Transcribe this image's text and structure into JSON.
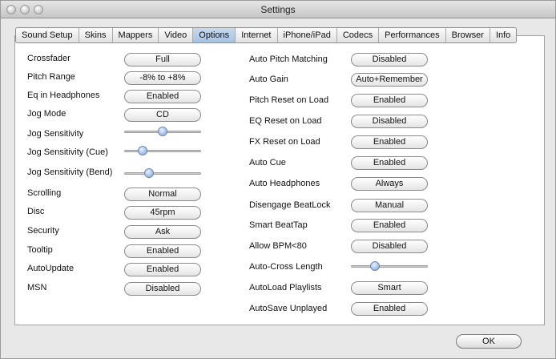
{
  "window": {
    "title": "Settings"
  },
  "tabs": [
    {
      "label": "Sound Setup"
    },
    {
      "label": "Skins"
    },
    {
      "label": "Mappers"
    },
    {
      "label": "Video"
    },
    {
      "label": "Options"
    },
    {
      "label": "Internet"
    },
    {
      "label": "iPhone/iPad"
    },
    {
      "label": "Codecs"
    },
    {
      "label": "Performances"
    },
    {
      "label": "Browser"
    },
    {
      "label": "Info"
    }
  ],
  "active_tab": "Options",
  "left": {
    "crossfader": {
      "label": "Crossfader",
      "value": "Full"
    },
    "pitch_range": {
      "label": "Pitch Range",
      "value": "-8% to +8%"
    },
    "eq_headphones": {
      "label": "Eq in Headphones",
      "value": "Enabled"
    },
    "jog_mode": {
      "label": "Jog Mode",
      "value": "CD"
    },
    "jog_sensitivity": {
      "label": "Jog Sensitivity",
      "level": 0.5
    },
    "jog_sensitivity_cue": {
      "label": "Jog Sensitivity (Cue)",
      "level": 0.2
    },
    "jog_sensitivity_bend": {
      "label": "Jog Sensitivity (Bend)",
      "level": 0.3
    },
    "scrolling": {
      "label": "Scrolling",
      "value": "Normal"
    },
    "disc": {
      "label": "Disc",
      "value": "45rpm"
    },
    "security": {
      "label": "Security",
      "value": "Ask"
    },
    "tooltip": {
      "label": "Tooltip",
      "value": "Enabled"
    },
    "autoupdate": {
      "label": "AutoUpdate",
      "value": "Enabled"
    },
    "msn": {
      "label": "MSN",
      "value": "Disabled"
    }
  },
  "right": {
    "auto_pitch_matching": {
      "label": "Auto Pitch Matching",
      "value": "Disabled"
    },
    "auto_gain": {
      "label": "Auto Gain",
      "value": "Auto+Remember"
    },
    "pitch_reset": {
      "label": "Pitch Reset on Load",
      "value": "Enabled"
    },
    "eq_reset": {
      "label": "EQ Reset on Load",
      "value": "Disabled"
    },
    "fx_reset": {
      "label": "FX Reset on Load",
      "value": "Enabled"
    },
    "auto_cue": {
      "label": "Auto Cue",
      "value": "Enabled"
    },
    "auto_headphones": {
      "label": "Auto Headphones",
      "value": "Always"
    },
    "disengage_beatlock": {
      "label": "Disengage BeatLock",
      "value": "Manual"
    },
    "smart_beattap": {
      "label": "Smart BeatTap",
      "value": "Enabled"
    },
    "allow_bpm": {
      "label": "Allow BPM<80",
      "value": "Disabled"
    },
    "auto_cross_length": {
      "label": "Auto-Cross Length",
      "level": 0.28
    },
    "autoload_playlists": {
      "label": "AutoLoad Playlists",
      "value": "Smart"
    },
    "autosave_unplayed": {
      "label": "AutoSave Unplayed",
      "value": "Enabled"
    }
  },
  "footer": {
    "ok_label": "OK"
  },
  "colors": {
    "active_tab": "#b4cbe8",
    "slider_knob": "#9fbde6",
    "panel_bg": "#ffffff",
    "window_bg": "#e8e8e8"
  }
}
